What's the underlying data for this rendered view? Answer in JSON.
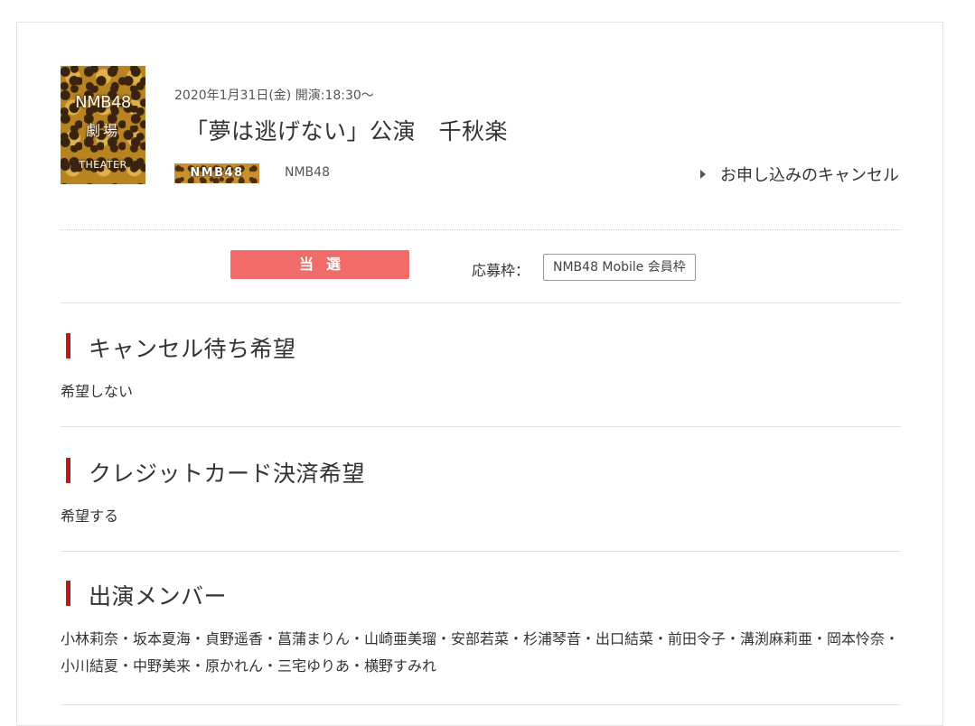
{
  "logo": {
    "line1": "NMB48",
    "line2": "劇場",
    "line3": "THEATER"
  },
  "event": {
    "datetime": "2020年1月31日(金) 開演:18:30〜",
    "title": "「夢は逃げない」公演　千秋楽",
    "group_badge": "NMB48",
    "group_name": "NMB48",
    "cancel_link": "お申し込みのキャンセル"
  },
  "status": {
    "result": "当選",
    "frame_label": "応募枠：",
    "frame_value": "NMB48 Mobile 会員枠"
  },
  "sections": [
    {
      "heading": "キャンセル待ち希望",
      "value": "希望しない"
    },
    {
      "heading": "クレジットカード決済希望",
      "value": "希望する"
    },
    {
      "heading": "出演メンバー",
      "value": "小林莉奈・坂本夏海・貞野遥香・菖蒲まりん・山崎亜美瑠・安部若菜・杉浦琴音・出口結菜・前田令子・溝渕麻莉亜・岡本怜奈・小川結夏・中野美来・原かれん・三宅ゆりあ・横野すみれ"
    }
  ],
  "colors": {
    "accent": "#b81a1a",
    "result_bg": "#f26b6b"
  }
}
